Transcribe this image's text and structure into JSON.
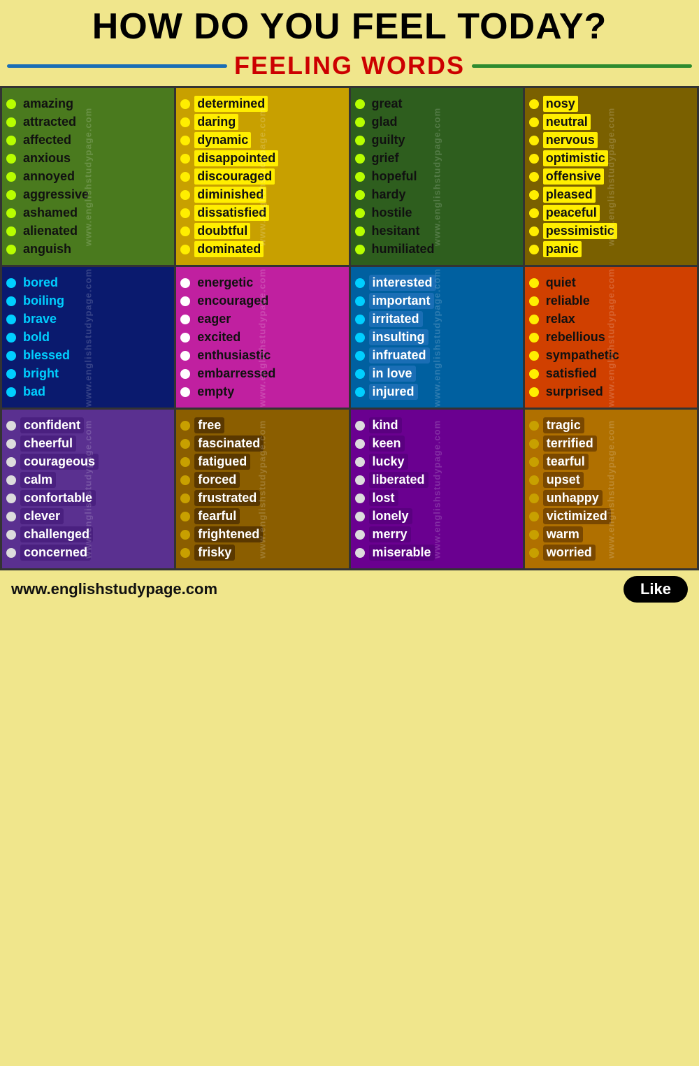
{
  "header": {
    "main_title": "HOW DO YOU FEEL TODAY?",
    "subtitle": "FEELING WORDS",
    "subtitle_line_left": "blue",
    "subtitle_line_right": "green"
  },
  "grid": {
    "rows": [
      {
        "cells": [
          {
            "class": "r1c1",
            "words": [
              "amazing",
              "attracted",
              "affected",
              "anxious",
              "annoyed",
              "aggressive",
              "ashamed",
              "alienated",
              "anguish"
            ]
          },
          {
            "class": "r1c2",
            "words": [
              "determined",
              "daring",
              "dynamic",
              "disappointed",
              "discouraged",
              "diminished",
              "dissatisfied",
              "doubtful",
              "dominated"
            ]
          },
          {
            "class": "r1c3",
            "words": [
              "great",
              "glad",
              "guilty",
              "grief",
              "hopeful",
              "hardy",
              "hostile",
              "hesitant",
              "humiliated"
            ]
          },
          {
            "class": "r1c4",
            "words": [
              "nosy",
              "neutral",
              "nervous",
              "optimistic",
              "offensive",
              "pleased",
              "peaceful",
              "pessimistic",
              "panic"
            ]
          }
        ]
      },
      {
        "cells": [
          {
            "class": "r2c1",
            "words": [
              "bored",
              "boiling",
              "brave",
              "bold",
              "blessed",
              "bright",
              "bad"
            ]
          },
          {
            "class": "r2c2",
            "words": [
              "energetic",
              "encouraged",
              "eager",
              "excited",
              "enthusiastic",
              "embarressed",
              "empty"
            ]
          },
          {
            "class": "r2c3",
            "words": [
              "interested",
              "important",
              "irritated",
              "insulting",
              "infruated",
              "in love",
              "injured"
            ]
          },
          {
            "class": "r2c4",
            "words": [
              "quiet",
              "reliable",
              "relax",
              "rebellious",
              "sympathetic",
              "satisfied",
              "surprised"
            ]
          }
        ]
      },
      {
        "cells": [
          {
            "class": "r3c1",
            "words": [
              "confident",
              "cheerful",
              "courageous",
              "calm",
              "confortable",
              "clever",
              "challenged",
              "concerned"
            ]
          },
          {
            "class": "r3c2",
            "words": [
              "free",
              "fascinated",
              "fatigued",
              "forced",
              "frustrated",
              "fearful",
              "frightened",
              "frisky"
            ]
          },
          {
            "class": "r3c3",
            "words": [
              "kind",
              "keen",
              "lucky",
              "liberated",
              "lost",
              "lonely",
              "merry",
              "miserable"
            ]
          },
          {
            "class": "r3c4",
            "words": [
              "tragic",
              "terrified",
              "tearful",
              "upset",
              "unhappy",
              "victimized",
              "warm",
              "worried"
            ]
          }
        ]
      }
    ]
  },
  "footer": {
    "url": "www.englishstudypage.com",
    "like": "Like"
  },
  "watermark": "www.englishstudypage.com"
}
